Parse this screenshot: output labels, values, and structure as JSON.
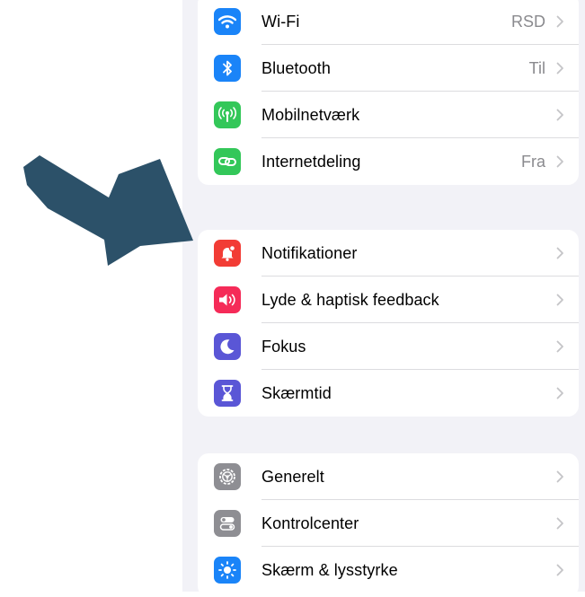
{
  "colors": {
    "page_background": "#ffffff",
    "settings_background": "#f2f2f7",
    "arrow": "#2c5169",
    "chevron": "#c4c4c7",
    "value_text": "#8a8a8e"
  },
  "groups": [
    {
      "items": [
        {
          "label": "Wi-Fi",
          "value": "RSD",
          "icon": "wifi-icon",
          "color": "#1a84f8"
        },
        {
          "label": "Bluetooth",
          "value": "Til",
          "icon": "bluetooth-icon",
          "color": "#1a84f8"
        },
        {
          "label": "Mobilnetværk",
          "value": "",
          "icon": "antenna-icon",
          "color": "#33c759"
        },
        {
          "label": "Internetdeling",
          "value": "Fra",
          "icon": "chain-link-icon",
          "color": "#33c759"
        }
      ]
    },
    {
      "items": [
        {
          "label": "Notifikationer",
          "value": "",
          "icon": "bell-icon",
          "color": "#f23c35"
        },
        {
          "label": "Lyde & haptisk feedback",
          "value": "",
          "icon": "speaker-icon",
          "color": "#f52b58"
        },
        {
          "label": "Fokus",
          "value": "",
          "icon": "moon-icon",
          "color": "#5a56d6"
        },
        {
          "label": "Skærmtid",
          "value": "",
          "icon": "hourglass-icon",
          "color": "#5a56d6"
        }
      ]
    },
    {
      "items": [
        {
          "label": "Generelt",
          "value": "",
          "icon": "gear-icon",
          "color": "#8e8e93"
        },
        {
          "label": "Kontrolcenter",
          "value": "",
          "icon": "toggles-icon",
          "color": "#8e8e93"
        },
        {
          "label": "Skærm & lysstyrke",
          "value": "",
          "icon": "sun-icon",
          "color": "#1a84f8"
        }
      ]
    }
  ]
}
